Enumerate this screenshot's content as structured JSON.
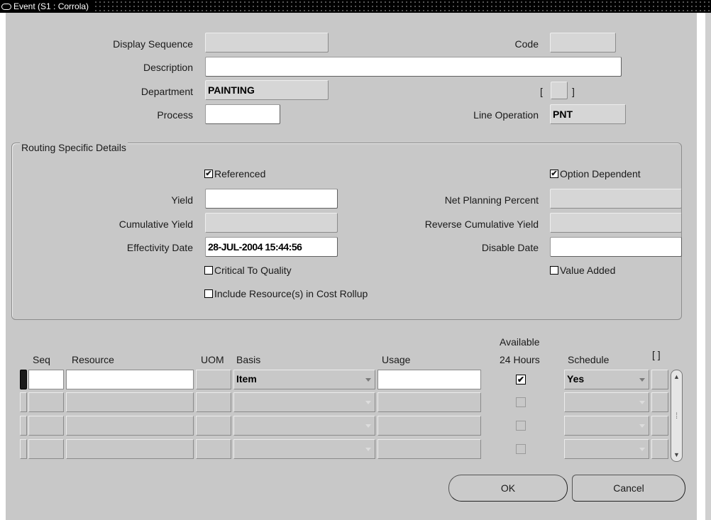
{
  "window": {
    "title": "Event (S1 : Corrola)"
  },
  "header": {
    "display_sequence": {
      "label": "Display Sequence",
      "value": ""
    },
    "code": {
      "label": "Code",
      "value": ""
    },
    "description": {
      "label": "Description",
      "value": ""
    },
    "department": {
      "label": "Department",
      "value": "PAINTING"
    },
    "bracket_field": {
      "open": "[",
      "close": "]",
      "value": ""
    },
    "process": {
      "label": "Process",
      "value": ""
    },
    "line_operation": {
      "label": "Line Operation",
      "value": "PNT"
    }
  },
  "routing": {
    "group_label": "Routing Specific Details",
    "referenced": {
      "label": "Referenced",
      "checked": true
    },
    "option_dependent": {
      "label": "Option Dependent",
      "checked": true
    },
    "yield": {
      "label": "Yield",
      "value": ""
    },
    "net_planning_percent": {
      "label": "Net Planning Percent",
      "value": ""
    },
    "cumulative_yield": {
      "label": "Cumulative Yield",
      "value": ""
    },
    "reverse_cumulative_yield": {
      "label": "Reverse Cumulative Yield",
      "value": ""
    },
    "effectivity_date": {
      "label": "Effectivity Date",
      "value": "28-JUL-2004 15:44:56"
    },
    "disable_date": {
      "label": "Disable Date",
      "value": ""
    },
    "critical_to_quality": {
      "label": "Critical To Quality",
      "checked": false
    },
    "value_added": {
      "label": "Value Added",
      "checked": false
    },
    "include_resources": {
      "label": "Include Resource(s) in Cost Rollup",
      "checked": false
    }
  },
  "grid": {
    "headers": {
      "seq": "Seq",
      "resource": "Resource",
      "uom": "UOM",
      "basis": "Basis",
      "usage": "Usage",
      "available_line1": "Available",
      "available_line2": "24 Hours",
      "schedule": "Schedule",
      "extra": "[ ]"
    },
    "rows": [
      {
        "seq": "",
        "resource": "",
        "uom": "",
        "basis": "Item",
        "usage": "",
        "available": true,
        "schedule": "Yes",
        "active": true
      },
      {
        "seq": "",
        "resource": "",
        "uom": "",
        "basis": "",
        "usage": "",
        "available": false,
        "schedule": "",
        "active": false
      },
      {
        "seq": "",
        "resource": "",
        "uom": "",
        "basis": "",
        "usage": "",
        "available": false,
        "schedule": "",
        "active": false
      },
      {
        "seq": "",
        "resource": "",
        "uom": "",
        "basis": "",
        "usage": "",
        "available": false,
        "schedule": "",
        "active": false
      }
    ]
  },
  "buttons": {
    "ok": "OK",
    "cancel": "Cancel"
  },
  "glyphs": {
    "check": "✔",
    "up": "▲",
    "down": "▼",
    "grip": "⁞"
  }
}
